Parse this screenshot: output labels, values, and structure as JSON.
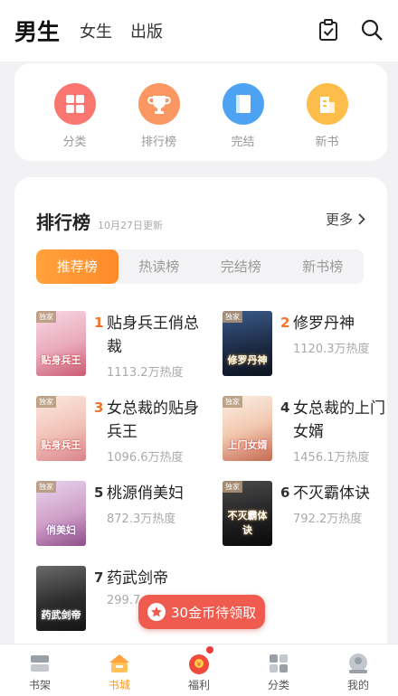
{
  "header": {
    "tabs": [
      {
        "label": "男生",
        "active": true
      },
      {
        "label": "女生",
        "active": false
      },
      {
        "label": "出版",
        "active": false
      }
    ],
    "icons": [
      "checkin-icon",
      "search-icon"
    ]
  },
  "quick": [
    {
      "label": "分类",
      "icon": "category-icon",
      "color": "#f97770"
    },
    {
      "label": "排行榜",
      "icon": "trophy-icon",
      "color": "#fb9762"
    },
    {
      "label": "完结",
      "icon": "book-icon",
      "color": "#4da3f2"
    },
    {
      "label": "新书",
      "icon": "newbook-icon",
      "color": "#fcbd4a"
    }
  ],
  "ranking": {
    "title": "排行榜",
    "date": "10月27日更新",
    "more": "更多",
    "tabs": [
      {
        "label": "推荐榜",
        "active": true
      },
      {
        "label": "热读榜",
        "active": false
      },
      {
        "label": "完结榜",
        "active": false
      },
      {
        "label": "新书榜",
        "active": false
      }
    ],
    "books": [
      {
        "rank": "1",
        "title": "贴身兵王俏总裁",
        "heat": "1113.2万热度",
        "cover_text": "贴身兵王",
        "tag": "独家"
      },
      {
        "rank": "2",
        "title": "修罗丹神",
        "heat": "1120.3万热度",
        "cover_text": "修罗丹神",
        "tag": "独家"
      },
      {
        "rank": "3",
        "title": "女总裁的贴身兵王",
        "heat": "1096.6万热度",
        "cover_text": "贴身兵王",
        "tag": "独家"
      },
      {
        "rank": "4",
        "title": "女总裁的上门女婿",
        "heat": "1456.1万热度",
        "cover_text": "上门女婿",
        "tag": "独家"
      },
      {
        "rank": "5",
        "title": "桃源俏美妇",
        "heat": "872.3万热度",
        "cover_text": "俏美妇",
        "tag": "独家"
      },
      {
        "rank": "6",
        "title": "不灭霸体诀",
        "heat": "792.2万热度",
        "cover_text": "不灭霸体诀",
        "tag": "独家"
      },
      {
        "rank": "7",
        "title": "药武剑帝",
        "heat": "299.7",
        "cover_text": "药武剑帝",
        "tag": ""
      }
    ]
  },
  "reward": {
    "label": "30金币待领取"
  },
  "tabbar": [
    {
      "label": "书架",
      "icon": "bookshelf-icon",
      "active": false
    },
    {
      "label": "书城",
      "icon": "bookstore-icon",
      "active": true
    },
    {
      "label": "福利",
      "icon": "redpacket-icon",
      "active": false,
      "badge": true
    },
    {
      "label": "分类",
      "icon": "category-grid-icon",
      "active": false
    },
    {
      "label": "我的",
      "icon": "profile-icon",
      "active": false
    }
  ],
  "colors": {
    "accent": "#ff9a2c",
    "rank_hot": "#f5732a",
    "rank_normal": "#333333",
    "reward": "#ef5b4e"
  }
}
